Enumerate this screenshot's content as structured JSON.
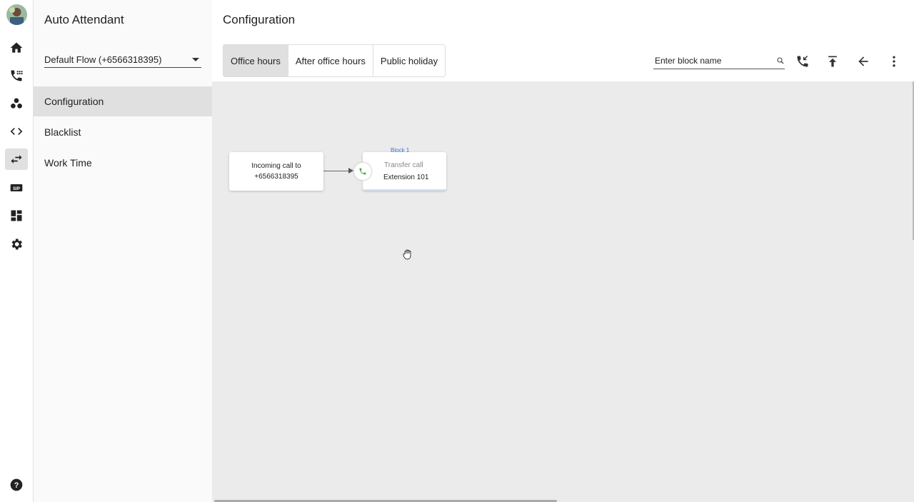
{
  "sidebar": {
    "title": "Auto Attendant",
    "flow_select": "Default Flow (+6566318395)",
    "items": [
      {
        "label": "Configuration",
        "active": true
      },
      {
        "label": "Blacklist",
        "active": false
      },
      {
        "label": "Work Time",
        "active": false
      }
    ]
  },
  "header": {
    "title": "Configuration",
    "tabs": [
      {
        "label": "Office hours",
        "active": true
      },
      {
        "label": "After office hours",
        "active": false
      },
      {
        "label": "Public holiday",
        "active": false
      }
    ],
    "search_placeholder": "Enter block name"
  },
  "rail": {
    "icons": [
      "home-icon",
      "phone-icon",
      "contacts-icon",
      "code-icon",
      "transfer-icon",
      "sip-icon",
      "dashboard-icon",
      "settings-icon",
      "help-icon"
    ],
    "sip_label": "SIP",
    "active_icon": "transfer-icon"
  },
  "canvas": {
    "start_node": {
      "line1": "Incoming call to",
      "line2": "+6566318395"
    },
    "block": {
      "label": "Block 1",
      "type": "Transfer call",
      "detail": "Extension 101"
    }
  },
  "colors": {
    "accent": "#3a7bd5",
    "phone_green": "#4caf50",
    "canvas_bg": "#ebebeb"
  }
}
